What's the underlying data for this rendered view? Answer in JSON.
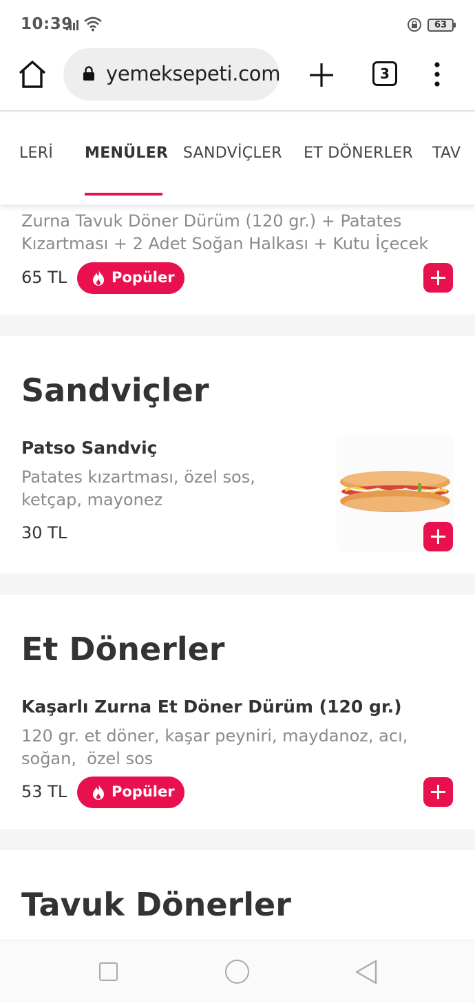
{
  "status_bar": {
    "time": "10:39",
    "battery": "63",
    "icons": [
      "signal-icon",
      "wifi-icon",
      "rotation-lock-icon",
      "battery-icon"
    ]
  },
  "browser": {
    "url": "yemeksepeti.com",
    "tab_count": "3",
    "icons": [
      "home-icon",
      "lock-icon",
      "plus-icon",
      "more-vertical-icon"
    ]
  },
  "category_nav": {
    "items": [
      {
        "label": "LERİ",
        "active": false
      },
      {
        "label": "MENÜLER",
        "active": true
      },
      {
        "label": "SANDVİÇLER",
        "active": false
      },
      {
        "label": "ET DÖNERLER",
        "active": false
      },
      {
        "label": "TAV",
        "active": false
      }
    ]
  },
  "menu_item_top": {
    "description": "Zurna Tavuk Döner Dürüm (120 gr.) + Patates Kızartması + 2 Adet Soğan Halkası + Kutu İçecek",
    "price": "65 TL",
    "badge": "Popüler"
  },
  "sections": {
    "sandvicler": {
      "title": "Sandviçler",
      "item": {
        "name": "Patso Sandviç",
        "description": "Patates kızartması, özel sos, ketçap, mayonez",
        "price": "30 TL"
      }
    },
    "et_donerler": {
      "title": "Et Dönerler",
      "item": {
        "name": "Kaşarlı Zurna Et Döner Dürüm (120 gr.)",
        "description": "120 gr. et döner, kaşar peyniri, maydanoz, acı, soğan,  özel sos",
        "price": "53 TL",
        "badge": "Popüler"
      }
    },
    "tavuk_donerler": {
      "title": "Tavuk Dönerler"
    }
  },
  "colors": {
    "accent": "#e8114e",
    "text": "#333333",
    "muted": "#8a8a8a",
    "divider": "#f5f5f5"
  },
  "system_nav": {
    "icons": [
      "recents-square-icon",
      "home-circle-icon",
      "back-triangle-icon"
    ]
  }
}
